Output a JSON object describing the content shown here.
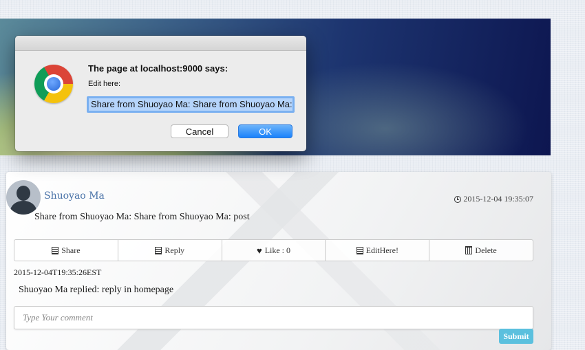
{
  "post": {
    "author": "Shuoyao Ma",
    "timestamp": "2015-12-04 19:35:07",
    "text": "Share from Shuoyao Ma: Share from Shuoyao Ma: post",
    "actions": {
      "share": "Share",
      "reply": "Reply",
      "like": "Like : 0",
      "edit": "EditHere!",
      "delete": "Delete"
    }
  },
  "reply": {
    "time": "2015-12-04T19:35:26EST",
    "text": "Shuoyao Ma replied: reply in homepage"
  },
  "comment": {
    "placeholder": "Type Your comment",
    "submit_label": "Submit"
  },
  "dialog": {
    "title": "The page at localhost:9000 says:",
    "message": "Edit here:",
    "input_value": "Share from Shuoyao Ma: Share from Shuoyao Ma: po",
    "cancel_label": "Cancel",
    "ok_label": "OK"
  },
  "icons": {
    "browser": "chrome-icon",
    "clock": "clock-icon",
    "share": "list-icon",
    "reply": "list-icon",
    "like": "heart-icon",
    "edit": "list-icon",
    "delete": "trash-icon"
  }
}
